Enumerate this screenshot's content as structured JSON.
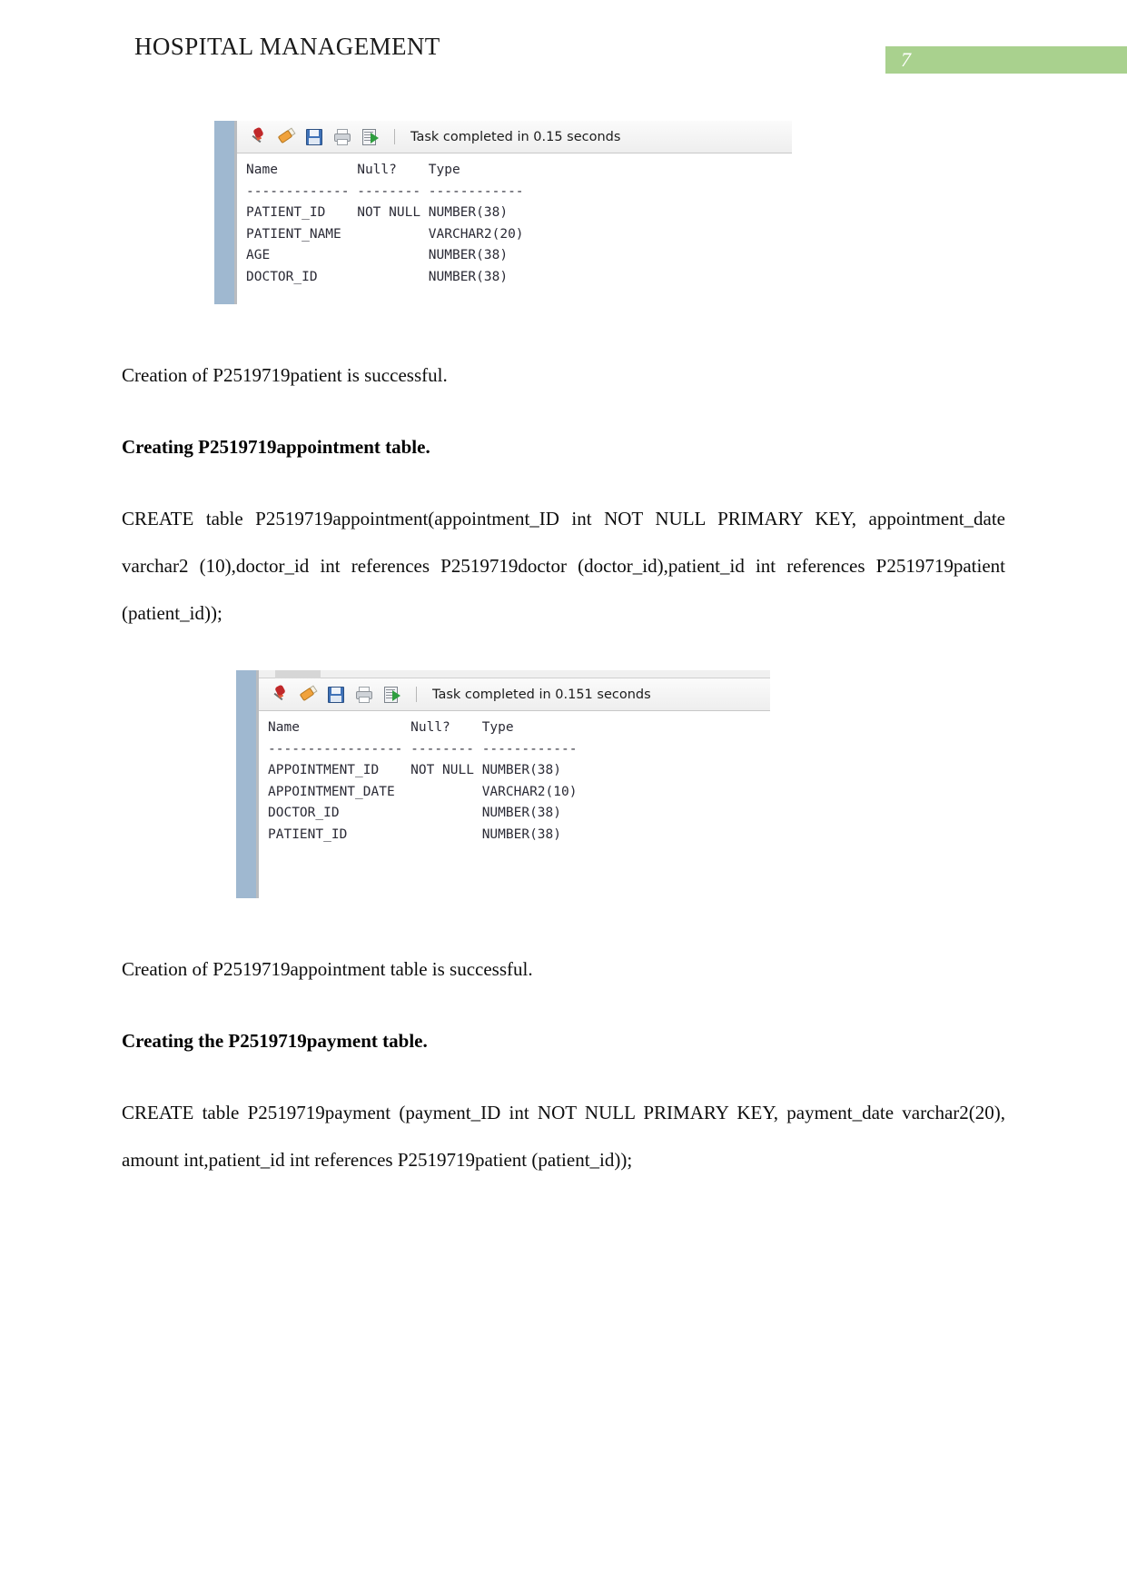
{
  "header": {
    "document_title": "HOSPITAL MANAGEMENT",
    "page_number": "7",
    "band_color": "#a9d18e"
  },
  "screenshot_1": {
    "status_text": "Task completed in 0.15 seconds",
    "toolbar_icons": [
      "pin-icon",
      "eraser-icon",
      "save-icon",
      "print-icon",
      "run-script-icon"
    ],
    "output": "Name          Null?    Type\n------------- -------- ------------\nPATIENT_ID    NOT NULL NUMBER(38)\nPATIENT_NAME           VARCHAR2(20)\nAGE                    NUMBER(38)\nDOCTOR_ID              NUMBER(38)",
    "columns": [
      "Name",
      "Null?",
      "Type"
    ],
    "rows": [
      {
        "name": "PATIENT_ID",
        "null": "NOT NULL",
        "type": "NUMBER(38)"
      },
      {
        "name": "PATIENT_NAME",
        "null": "",
        "type": "VARCHAR2(20)"
      },
      {
        "name": "AGE",
        "null": "",
        "type": "NUMBER(38)"
      },
      {
        "name": "DOCTOR_ID",
        "null": "",
        "type": "NUMBER(38)"
      }
    ]
  },
  "paragraph_1": "Creation of P2519719patient is successful.",
  "heading_1": "Creating P2519719appointment table.",
  "sql_1": "CREATE table P2519719appointment(appointment_ID int NOT NULL PRIMARY KEY, appointment_date varchar2 (10),doctor_id int references P2519719doctor (doctor_id),patient_id int references P2519719patient (patient_id));",
  "screenshot_2": {
    "status_text": "Task completed in 0.151 seconds",
    "toolbar_icons": [
      "pin-icon",
      "eraser-icon",
      "save-icon",
      "print-icon",
      "run-script-icon"
    ],
    "output": "Name              Null?    Type\n----------------- -------- ------------\nAPPOINTMENT_ID    NOT NULL NUMBER(38)\nAPPOINTMENT_DATE           VARCHAR2(10)\nDOCTOR_ID                  NUMBER(38)\nPATIENT_ID                 NUMBER(38)",
    "columns": [
      "Name",
      "Null?",
      "Type"
    ],
    "rows": [
      {
        "name": "APPOINTMENT_ID",
        "null": "NOT NULL",
        "type": "NUMBER(38)"
      },
      {
        "name": "APPOINTMENT_DATE",
        "null": "",
        "type": "VARCHAR2(10)"
      },
      {
        "name": "DOCTOR_ID",
        "null": "",
        "type": "NUMBER(38)"
      },
      {
        "name": "PATIENT_ID",
        "null": "",
        "type": "NUMBER(38)"
      }
    ]
  },
  "paragraph_2": "Creation of P2519719appointment table is successful.",
  "heading_2": "Creating the P2519719payment table.",
  "sql_2": "CREATE table P2519719payment (payment_ID int NOT NULL PRIMARY KEY, payment_date varchar2(20), amount int,patient_id int references P2519719patient (patient_id));"
}
